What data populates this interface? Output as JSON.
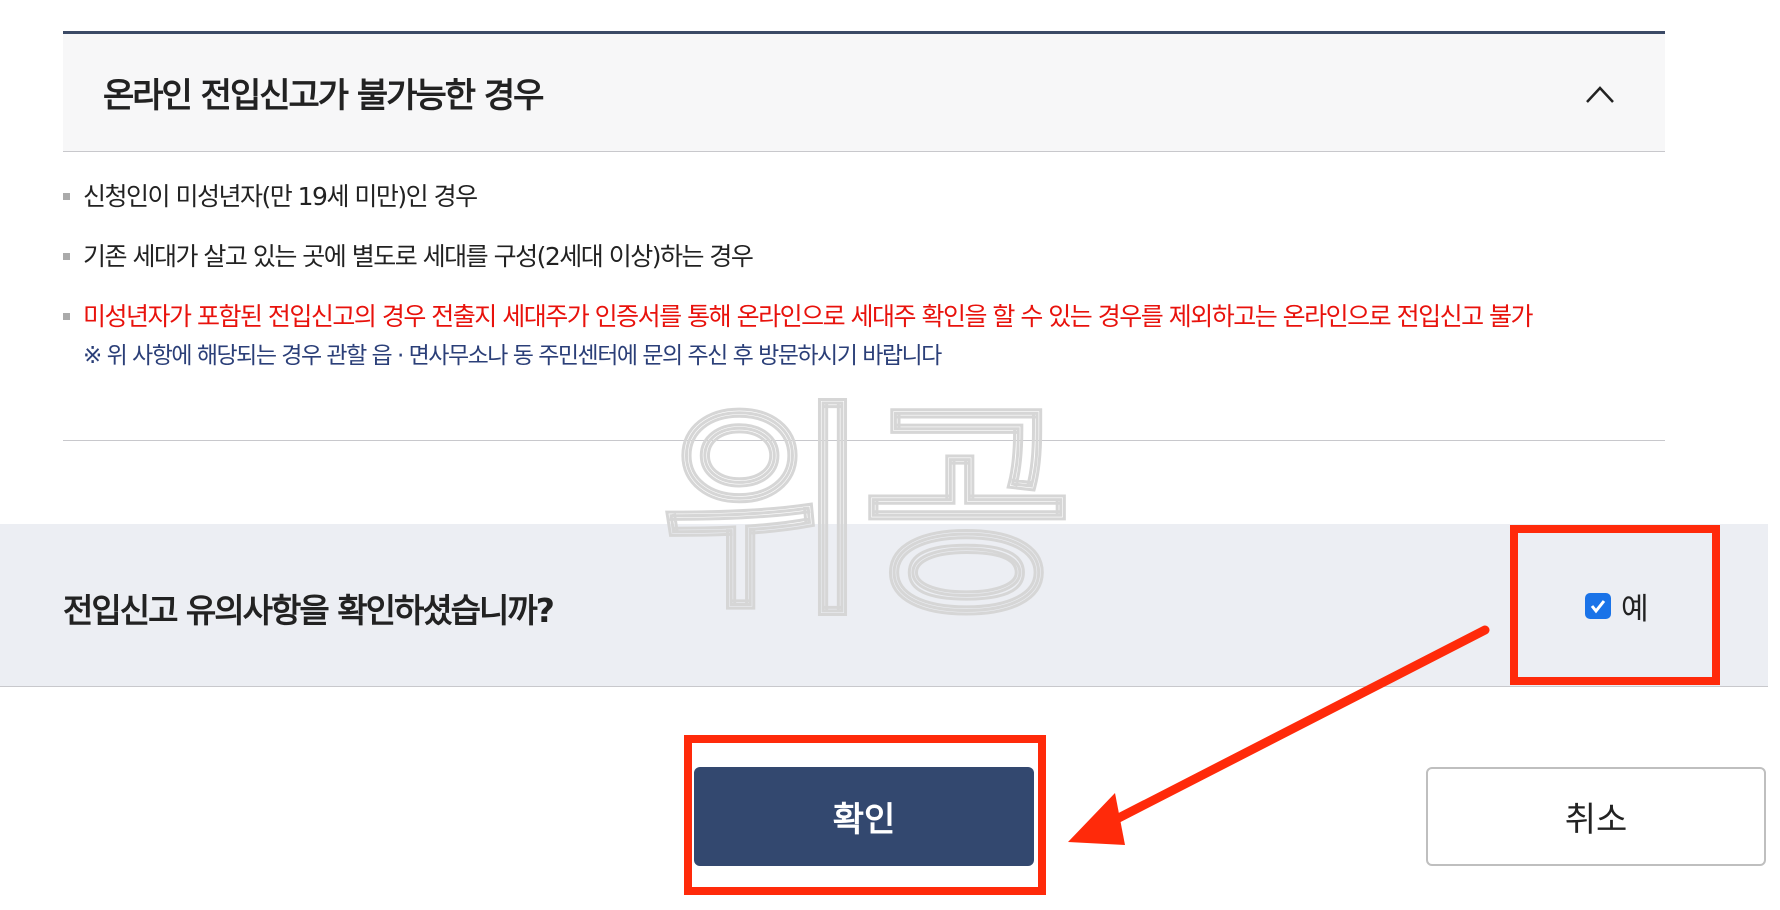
{
  "section": {
    "title": "온라인 전입신고가 불가능한 경우",
    "items": [
      "신청인이 미성년자(만 19세 미만)인 경우",
      "기존 세대가 살고 있는 곳에 별도로 세대를 구성(2세대 이상)하는 경우",
      "미성년자가 포함된 전입신고의 경우 전출지 세대주가 인증서를 통해 온라인으로 세대주 확인을 할 수 있는 경우를 제외하고는 온라인으로 전입신고 불가"
    ],
    "note": "※ 위 사항에 해당되는 경우 관할 읍 · 면사무소나 동 주민센터에 문의 주신 후 방문하시기 바랍니다"
  },
  "watermark": "위공",
  "confirm": {
    "question": "전입신고 유의사항을 확인하셨습니까?",
    "checkbox_label": "예",
    "checked": true
  },
  "buttons": {
    "confirm_label": "확인",
    "cancel_label": "취소"
  },
  "colors": {
    "primary": "#33486f",
    "warning_text": "#e8120c",
    "note_text": "#2b3f78",
    "annotation": "#ff2a0a",
    "checkbox": "#1a73e8"
  }
}
